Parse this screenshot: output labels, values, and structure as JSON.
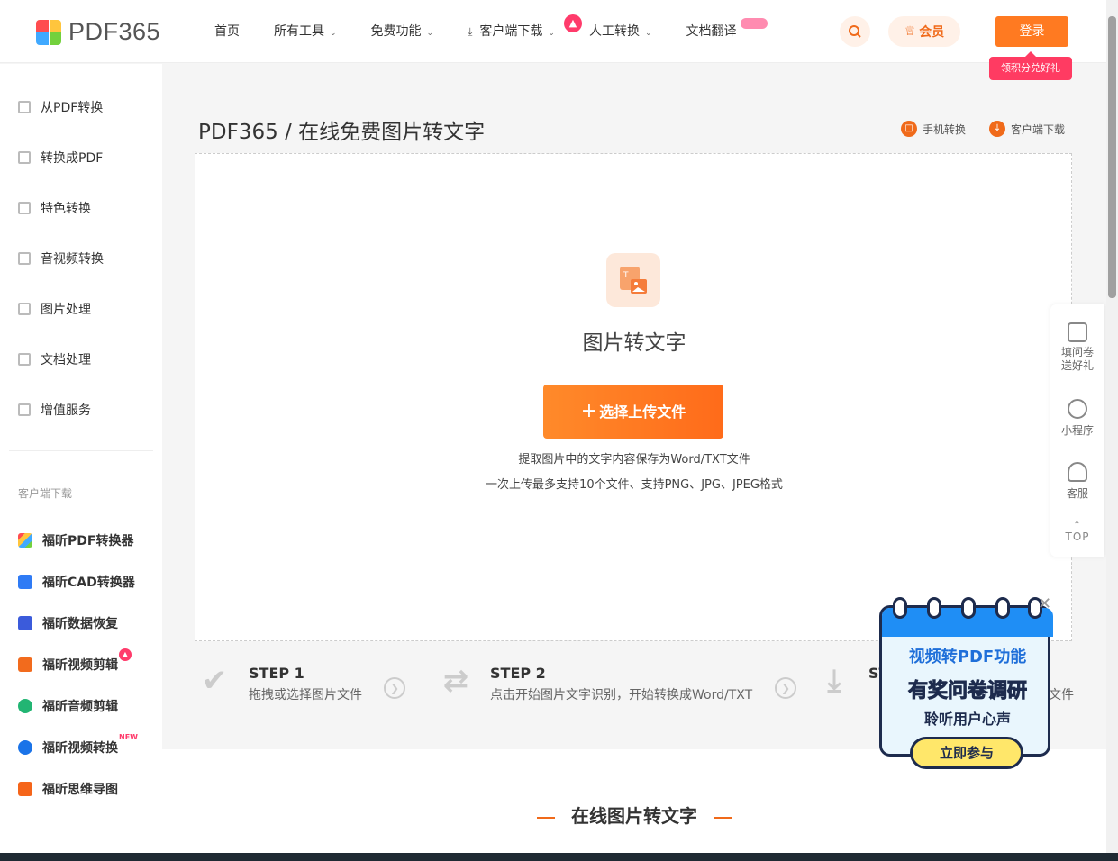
{
  "header": {
    "logo_text": "PDF365",
    "nav": [
      {
        "label": "首页"
      },
      {
        "label": "所有工具"
      },
      {
        "label": "免费功能"
      },
      {
        "label": "客户端下载"
      },
      {
        "label": "人工转换"
      },
      {
        "label": "文档翻译"
      }
    ],
    "vip_label": "会员",
    "login_label": "登录",
    "promo_tag": "领积分兑好礼"
  },
  "sidebar": {
    "items": [
      {
        "label": "从PDF转换"
      },
      {
        "label": "转换成PDF"
      },
      {
        "label": "特色转换"
      },
      {
        "label": "音视频转换"
      },
      {
        "label": "图片处理"
      },
      {
        "label": "文档处理"
      },
      {
        "label": "增值服务"
      }
    ],
    "downloads_heading": "客户端下载",
    "apps": [
      {
        "label": "福昕PDF转换器",
        "color": "#4a90e2"
      },
      {
        "label": "福昕CAD转换器",
        "color": "#2f7bf5"
      },
      {
        "label": "福昕数据恢复",
        "color": "#3b5bdb"
      },
      {
        "label": "福昕视频剪辑",
        "color": "#f26b1d"
      },
      {
        "label": "福昕音频剪辑",
        "color": "#22b573"
      },
      {
        "label": "福昕视频转换",
        "color": "#1a73e8"
      },
      {
        "label": "福昕思维导图",
        "color": "#f5651a"
      }
    ],
    "new_badge": "NEW"
  },
  "main": {
    "breadcrumb": "PDF365 / 在线免费图片转文字",
    "links": [
      {
        "label": "手机转换"
      },
      {
        "label": "客户端下载"
      }
    ],
    "tool_title": "图片转文字",
    "upload_label": "选择上传文件",
    "desc1": "提取图片中的文字内容保存为Word/TXT文件",
    "desc2": "一次上传最多支持10个文件、支持PNG、JPG、JPEG格式",
    "steps": [
      {
        "title": "STEP 1",
        "text": "拖拽或选择图片文件"
      },
      {
        "title": "STEP 2",
        "text": "点击开始图片文字识别，开始转换成Word/TXT"
      },
      {
        "title": "ST",
        "text": "文件"
      }
    ],
    "section_title": "在线图片转文字"
  },
  "float_panel": {
    "items": [
      {
        "label": "填问卷送好礼"
      },
      {
        "label": "小程序"
      },
      {
        "label": "客服"
      }
    ],
    "top_label": "TOP"
  },
  "survey": {
    "line1": "视频转PDF功能",
    "line2": "有奖问卷调研",
    "line3": "聆听用户心声",
    "button": "立即参与"
  },
  "colors": {
    "accent": "#ff7a21",
    "promo": "#ff3b62"
  }
}
